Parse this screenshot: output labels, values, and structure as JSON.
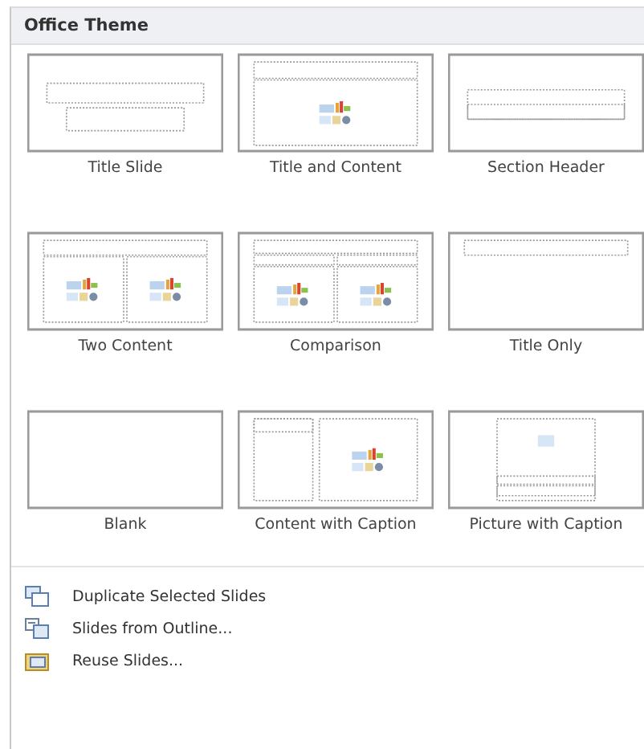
{
  "gallery": {
    "title": "Office Theme",
    "layouts": [
      {
        "label": "Title Slide",
        "kind": "title",
        "selected": false
      },
      {
        "label": "Title and Content",
        "kind": "title-content",
        "selected": false
      },
      {
        "label": "Section Header",
        "kind": "section",
        "selected": false
      },
      {
        "label": "Two Content",
        "kind": "two-content",
        "selected": false
      },
      {
        "label": "Comparison",
        "kind": "comparison",
        "selected": false
      },
      {
        "label": "Title Only",
        "kind": "title-only",
        "selected": false
      },
      {
        "label": "Blank",
        "kind": "blank",
        "selected": false
      },
      {
        "label": "Content with Caption",
        "kind": "content-caption",
        "selected": false
      },
      {
        "label": "Picture with Caption",
        "kind": "picture-caption",
        "selected": false
      }
    ]
  },
  "menu": [
    {
      "label": "Duplicate Selected Slides",
      "kind": "duplicate"
    },
    {
      "label": "Slides from Outline...",
      "kind": "outline"
    },
    {
      "label": "Reuse Slides...",
      "kind": "reuse"
    }
  ]
}
